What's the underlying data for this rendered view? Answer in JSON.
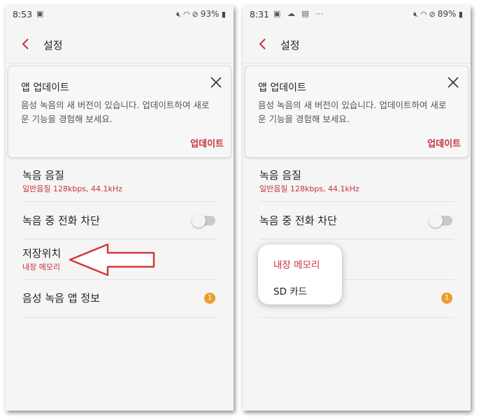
{
  "colors": {
    "accent": "#c8323c",
    "badge": "#ed9c2e",
    "background": "#f5f5f5"
  },
  "left": {
    "status": {
      "time": "8:53",
      "battery": "93%",
      "left_icons": [
        "image-icon"
      ]
    },
    "app_title": "설정",
    "card": {
      "title": "앱 업데이트",
      "description": "음성 녹음의 새 버전이 있습니다. 업데이트하여 새로운 기능을 경험해 보세요.",
      "action": "업데이트"
    },
    "settings": {
      "quality_title": "녹음 음질",
      "quality_value": "일반음질 128kbps, 44.1kHz",
      "block_calls_title": "녹음 중 전화 차단",
      "storage_title": "저장위치",
      "storage_value": "내장 메모리",
      "about_title": "음성 녹음 앱 정보",
      "about_badge": "1"
    }
  },
  "right": {
    "status": {
      "time": "8:31",
      "battery": "89%",
      "left_icons": [
        "image-icon",
        "cloud-icon",
        "app-icon",
        "more-icon"
      ]
    },
    "app_title": "설정",
    "card": {
      "title": "앱 업데이트",
      "description": "음성 녹음의 새 버전이 있습니다. 업데이트하여 새로운 기능을 경험해 보세요.",
      "action": "업데이트"
    },
    "settings": {
      "quality_title": "녹음 음질",
      "quality_value": "일반음질 128kbps, 44.1kHz",
      "block_calls_title": "녹음 중 전화 차단",
      "about_badge": "1"
    },
    "popup": {
      "options": [
        "내장 메모리",
        "SD 카드"
      ],
      "selected": "내장 메모리"
    }
  }
}
